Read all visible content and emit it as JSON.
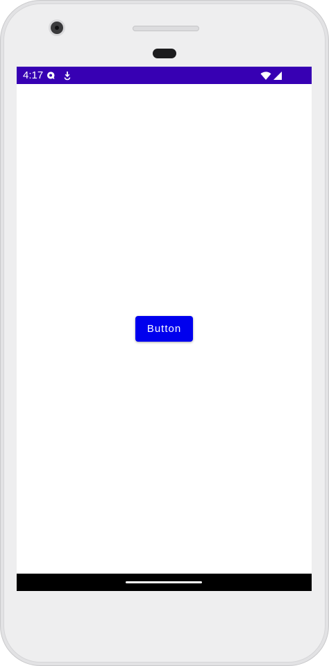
{
  "status_bar": {
    "time": "4:17",
    "background": "#3700b3",
    "left_icons": [
      "chat-bubble-icon",
      "download-icon"
    ],
    "right_icons": [
      "wifi-icon",
      "cellular-signal-icon"
    ]
  },
  "main": {
    "button_label": "Button",
    "button_color": "#0000ee"
  },
  "nav_bar": {
    "background": "#000000",
    "handle": "home-gesture-handle"
  }
}
